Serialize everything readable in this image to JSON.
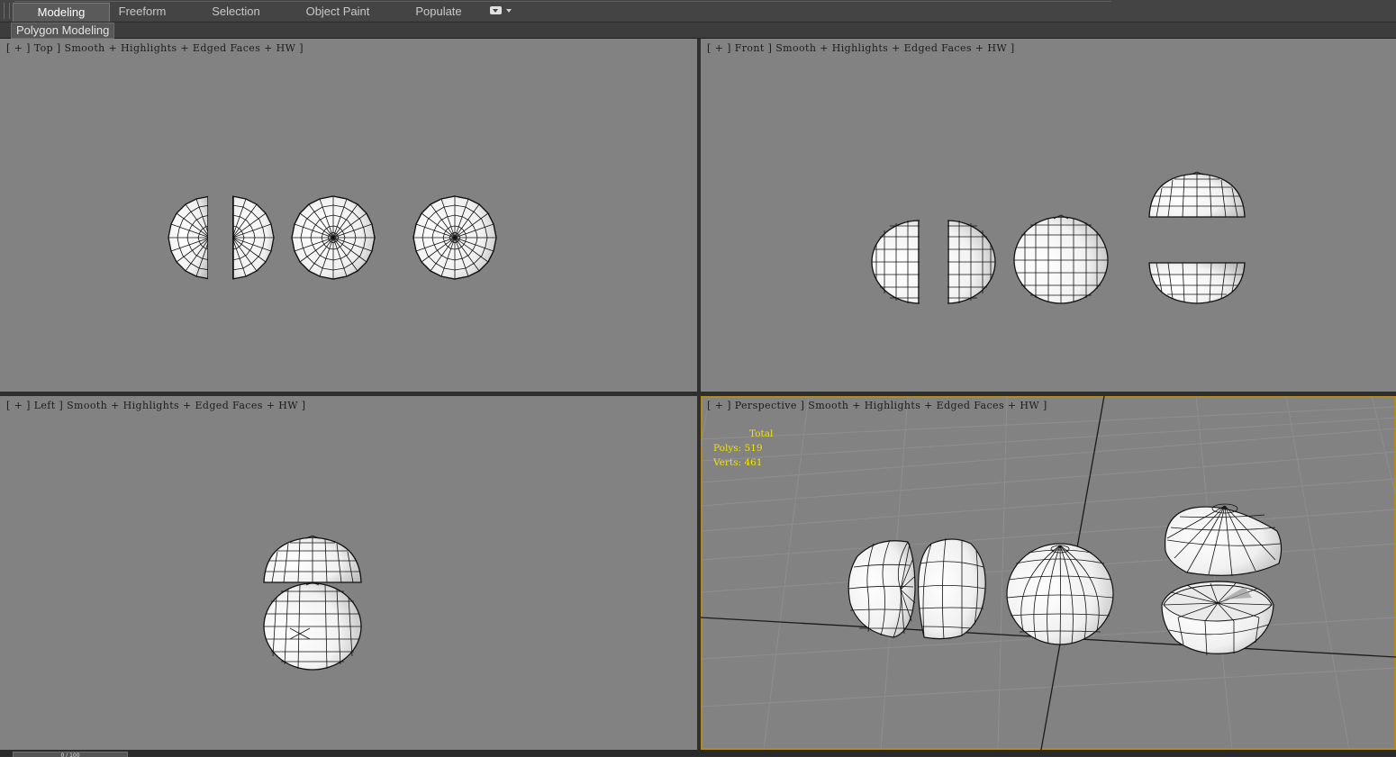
{
  "ribbon": {
    "tabs": [
      {
        "label": "Modeling",
        "active": true
      },
      {
        "label": "Freeform",
        "active": false
      },
      {
        "label": "Selection",
        "active": false
      },
      {
        "label": "Object Paint",
        "active": false
      },
      {
        "label": "Populate",
        "active": false
      }
    ],
    "panel_button": "Polygon Modeling"
  },
  "viewports": {
    "top": {
      "label": "[ + ] Top ] Smooth + Highlights + Edged Faces + HW ]"
    },
    "front": {
      "label": "[ + ] Front ] Smooth + Highlights + Edged Faces + HW ]"
    },
    "left": {
      "label": "[ + ] Left ] Smooth + Highlights + Edged Faces + HW ]"
    },
    "perspective": {
      "label": "[ + ] Perspective ] Smooth + Highlights + Edged Faces + HW ]",
      "stats": {
        "title": "Total",
        "polys": "Polys: 519",
        "verts": "Verts: 461"
      }
    }
  },
  "colors": {
    "viewport_bg": "#828282",
    "active_border": "#b08c1e",
    "stats_text": "#f2e200",
    "mesh_fill": "#f4f4f4",
    "wire": "#111111"
  },
  "time_slider": {
    "label": "0 / 100"
  }
}
